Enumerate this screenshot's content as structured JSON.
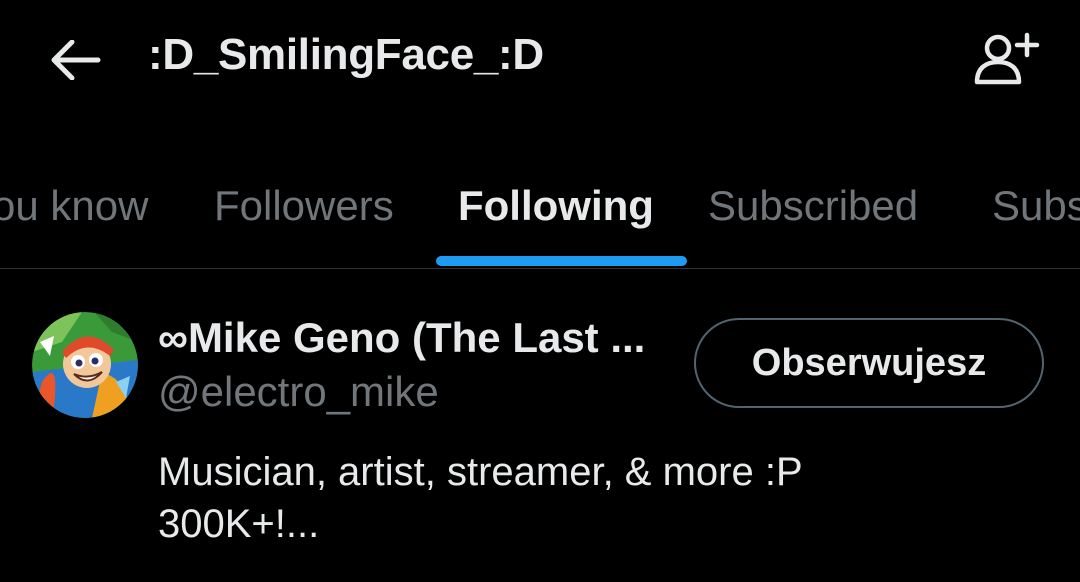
{
  "header": {
    "title": ":D_SmilingFace_:D",
    "back_icon": "arrow-left-icon",
    "add_user_icon": "person-plus-icon"
  },
  "tabs": [
    {
      "label": "ou know",
      "active": false
    },
    {
      "label": "Followers",
      "active": false
    },
    {
      "label": "Following",
      "active": true
    },
    {
      "label": "Subscribed",
      "active": false
    },
    {
      "label": "Subs",
      "active": false
    }
  ],
  "accent_color": "#1d9bf0",
  "user": {
    "display_name": "∞Mike Geno (The Last ...",
    "handle": "@electro_mike",
    "follow_button_label": "Obserwujesz",
    "bio_lines": [
      "Musician, artist, streamer, & more :P",
      "300K+!..."
    ]
  }
}
